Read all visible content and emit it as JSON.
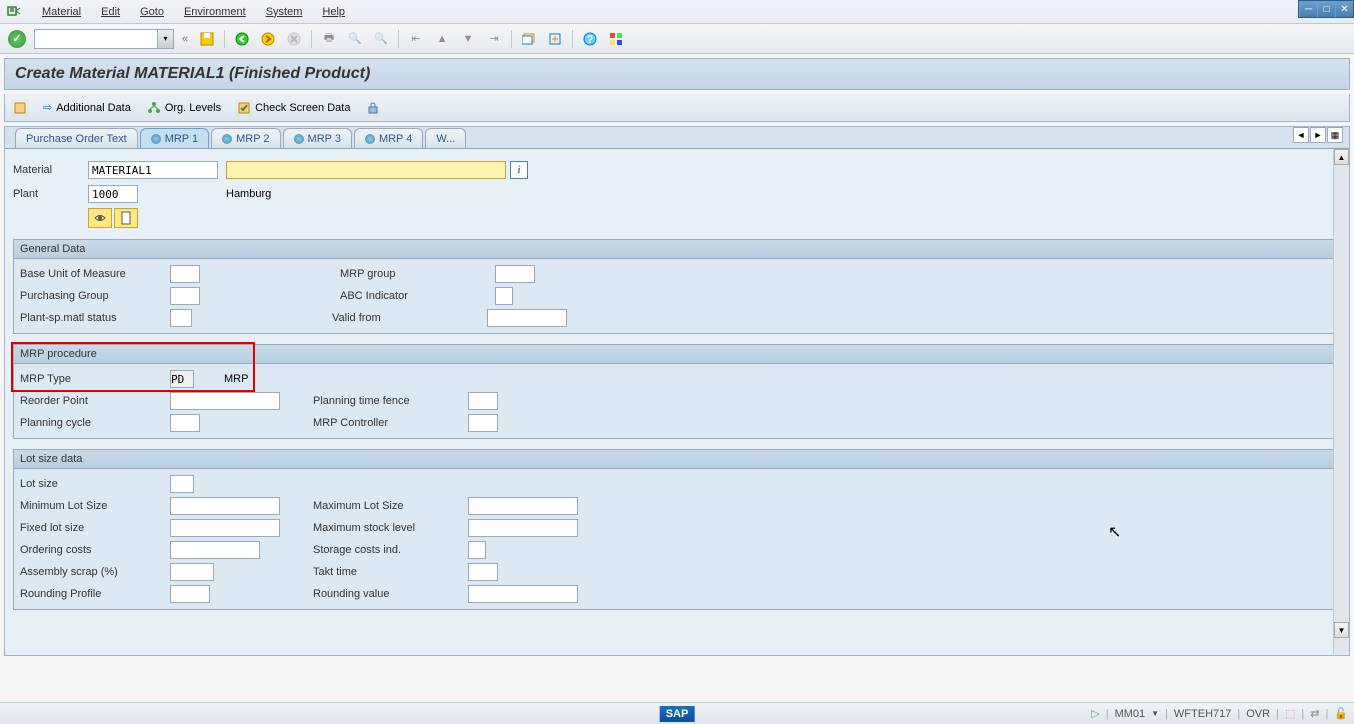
{
  "menu": {
    "items": [
      "Material",
      "Edit",
      "Goto",
      "Environment",
      "System",
      "Help"
    ]
  },
  "title": "Create Material MATERIAL1 (Finished Product)",
  "subtoolbar": {
    "additional_data": "Additional Data",
    "org_levels": "Org. Levels",
    "check_screen": "Check Screen Data"
  },
  "tabs": {
    "t0": "Purchase Order Text",
    "t1": "MRP 1",
    "t2": "MRP 2",
    "t3": "MRP 3",
    "t4": "MRP 4",
    "t5": "W..."
  },
  "header_fields": {
    "material_label": "Material",
    "material_value": "MATERIAL1",
    "material_desc": "",
    "plant_label": "Plant",
    "plant_value": "1000",
    "plant_desc": "Hamburg"
  },
  "general_data": {
    "title": "General Data",
    "base_uom": "Base Unit of Measure",
    "mrp_group": "MRP group",
    "purchasing_group": "Purchasing Group",
    "abc_indicator": "ABC Indicator",
    "plant_status": "Plant-sp.matl status",
    "valid_from": "Valid from"
  },
  "mrp_procedure": {
    "title": "MRP procedure",
    "mrp_type_label": "MRP Type",
    "mrp_type_value": "PD",
    "mrp_type_desc": "MRP",
    "reorder_point": "Reorder Point",
    "planning_time_fence": "Planning time fence",
    "planning_cycle": "Planning cycle",
    "mrp_controller": "MRP Controller"
  },
  "lot_size": {
    "title": "Lot size data",
    "lot_size": "Lot size",
    "min_lot": "Minimum Lot Size",
    "max_lot": "Maximum Lot Size",
    "fixed_lot": "Fixed lot size",
    "max_stock": "Maximum stock level",
    "ordering_costs": "Ordering costs",
    "storage_costs": "Storage costs ind.",
    "assembly_scrap": "Assembly scrap (%)",
    "takt_time": "Takt time",
    "rounding_profile": "Rounding Profile",
    "rounding_value": "Rounding value"
  },
  "statusbar": {
    "tcode": "MM01",
    "system": "WFTEH717",
    "mode": "OVR"
  }
}
